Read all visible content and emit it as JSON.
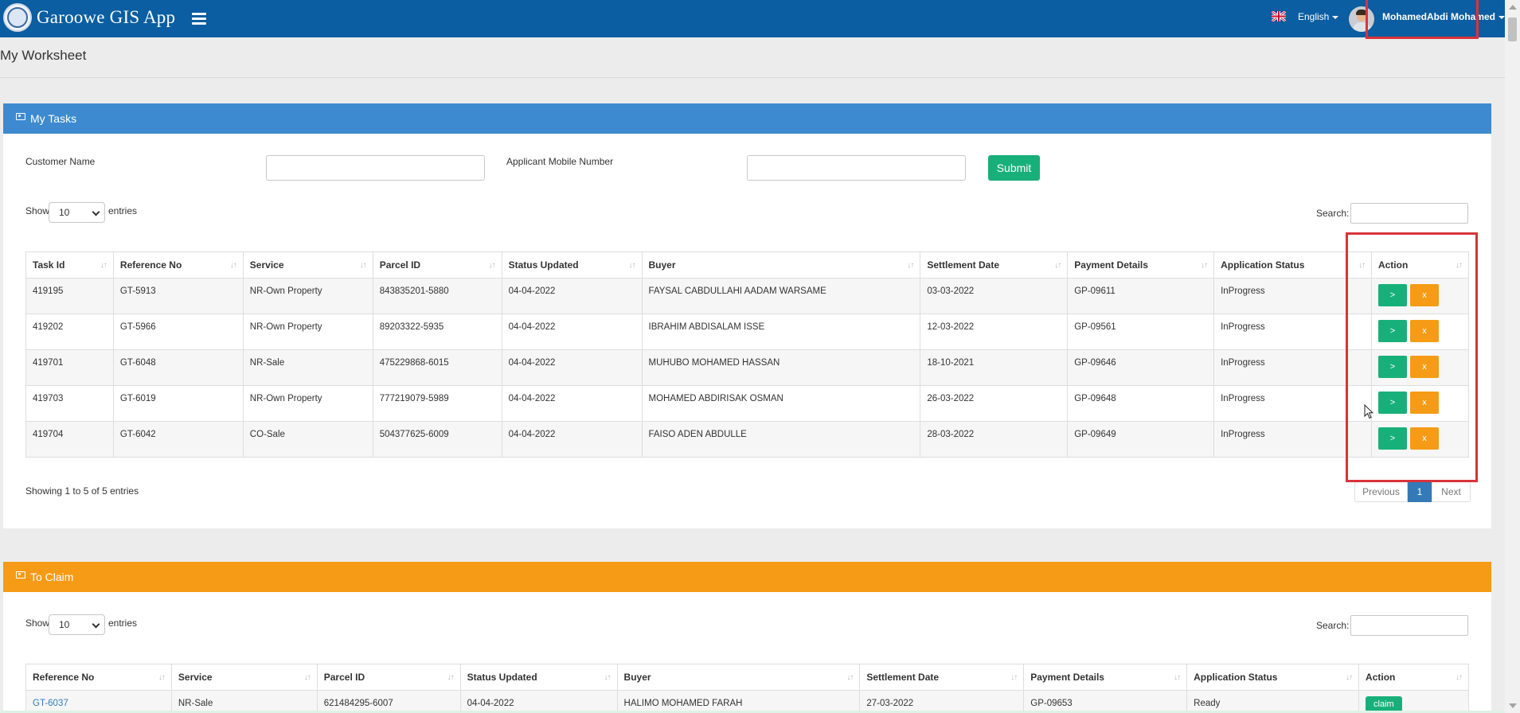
{
  "app": {
    "name": "Garoowe GIS App",
    "language": "English",
    "user": "MohamedAbdi Mohamed"
  },
  "page": {
    "title": "My Worksheet"
  },
  "colors": {
    "navbar": "#0a5ea1",
    "tasks_header": "#3d8ad0",
    "claim_header": "#f59b16",
    "success": "#18b07a",
    "highlight": "#d9333a"
  },
  "tasks": {
    "header": "My Tasks",
    "customer_label": "Customer Name",
    "mobile_label": "Applicant Mobile Number",
    "submit": "Submit",
    "show_label": "Show",
    "show_value": "10",
    "entries_label": "entries",
    "search_label": "Search:",
    "columns": [
      "Task Id",
      "Reference No",
      "Service",
      "Parcel ID",
      "Status Updated",
      "Buyer",
      "Settlement Date",
      "Payment Details",
      "Application Status",
      "Action"
    ],
    "rows": [
      {
        "task_id": "419195",
        "ref": "GT-5913",
        "service": "NR-Own Property",
        "parcel": "843835201-5880",
        "updated": "04-04-2022",
        "buyer": "FAYSAL CABDULLAHI AADAM WARSAME",
        "settlement": "03-03-2022",
        "payment": "GP-09611",
        "status": "InProgress"
      },
      {
        "task_id": "419202",
        "ref": "GT-5966",
        "service": "NR-Own Property",
        "parcel": "89203322-5935",
        "updated": "04-04-2022",
        "buyer": "IBRAHIM ABDISALAM ISSE",
        "settlement": "12-03-2022",
        "payment": "GP-09561",
        "status": "InProgress"
      },
      {
        "task_id": "419701",
        "ref": "GT-6048",
        "service": "NR-Sale",
        "parcel": "475229868-6015",
        "updated": "04-04-2022",
        "buyer": "MUHUBO MOHAMED HASSAN",
        "settlement": "18-10-2021",
        "payment": "GP-09646",
        "status": "InProgress"
      },
      {
        "task_id": "419703",
        "ref": "GT-6019",
        "service": "NR-Own Property",
        "parcel": "777219079-5989",
        "updated": "04-04-2022",
        "buyer": "MOHAMED ABDIRISAK OSMAN",
        "settlement": "26-03-2022",
        "payment": "GP-09648",
        "status": "InProgress"
      },
      {
        "task_id": "419704",
        "ref": "GT-6042",
        "service": "CO-Sale",
        "parcel": "504377625-6009",
        "updated": "04-04-2022",
        "buyer": "FAISO ADEN ABDULLE",
        "settlement": "28-03-2022",
        "payment": "GP-09649",
        "status": "InProgress"
      }
    ],
    "action_go": ">",
    "action_x": "x",
    "info": "Showing 1 to 5 of 5 entries",
    "pager": {
      "prev": "Previous",
      "current": "1",
      "next": "Next"
    }
  },
  "claim": {
    "header": "To Claim",
    "show_label": "Show",
    "show_value": "10",
    "entries_label": "entries",
    "search_label": "Search:",
    "columns": [
      "Reference No",
      "Service",
      "Parcel ID",
      "Status Updated",
      "Buyer",
      "Settlement Date",
      "Payment Details",
      "Application Status",
      "Action"
    ],
    "rows": [
      {
        "ref": "GT-6037",
        "service": "NR-Sale",
        "parcel": "621484295-6007",
        "updated": "04-04-2022",
        "buyer": "HALIMO MOHAMED FARAH",
        "settlement": "27-03-2022",
        "payment": "GP-09653",
        "status": "Ready",
        "action": "claim"
      }
    ]
  }
}
